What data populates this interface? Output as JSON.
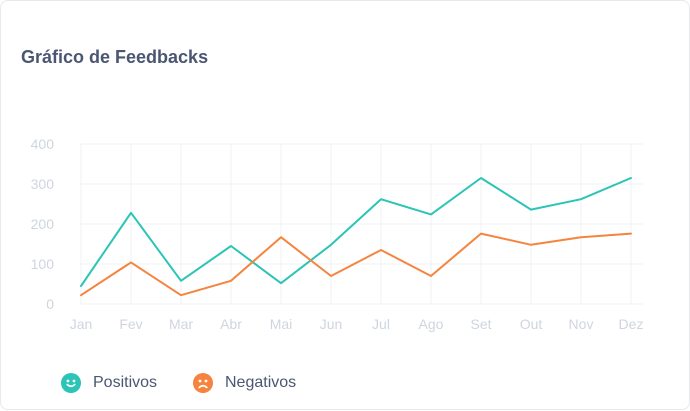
{
  "title": "Gráfico de Feedbacks",
  "colors": {
    "positive": "#2bc4b6",
    "negative": "#f5843f",
    "grid": "#eef0f4",
    "tick": "#cfd5df"
  },
  "chart_data": {
    "type": "line",
    "categories": [
      "Jan",
      "Fev",
      "Mar",
      "Abr",
      "Mai",
      "Jun",
      "Jul",
      "Ago",
      "Set",
      "Out",
      "Nov",
      "Dez"
    ],
    "ylim": [
      0,
      400
    ],
    "yticks": [
      "400",
      "300",
      "200",
      "100",
      "0"
    ],
    "grid": true,
    "legend_position": "bottom-left",
    "series": [
      {
        "name": "Positivos",
        "color": "#2bc4b6",
        "icon": "smile-icon",
        "values": [
          45,
          228,
          58,
          145,
          52,
          148,
          262,
          224,
          315,
          236,
          262,
          315
        ]
      },
      {
        "name": "Negativos",
        "color": "#f5843f",
        "icon": "frown-icon",
        "values": [
          22,
          104,
          22,
          58,
          167,
          70,
          135,
          70,
          176,
          148,
          167,
          176
        ]
      }
    ]
  }
}
